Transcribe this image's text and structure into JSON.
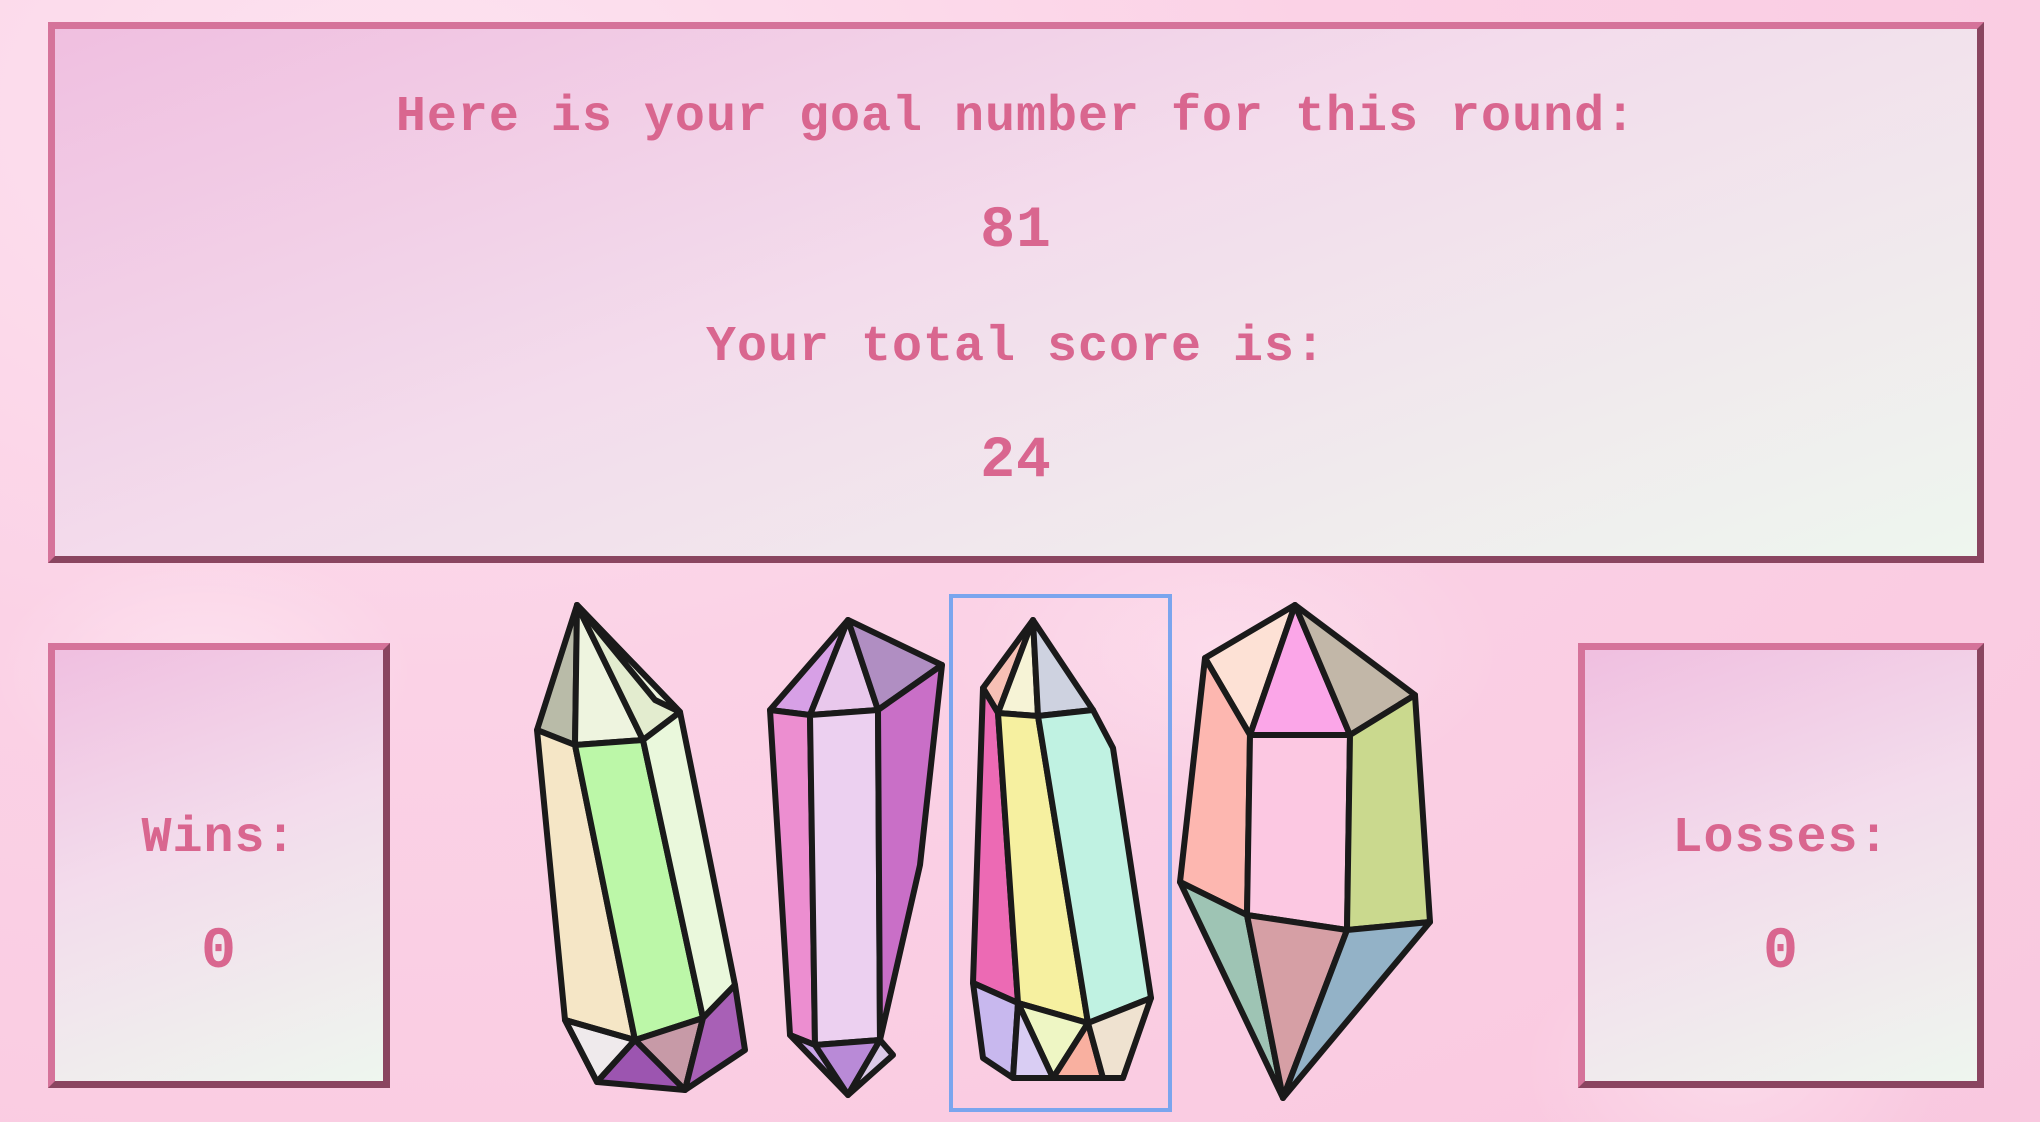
{
  "goal": {
    "label": "Here is your goal number for this round:",
    "value": "81"
  },
  "score": {
    "label": "Your total score is:",
    "value": "24"
  },
  "wins": {
    "label": "Wins:",
    "value": "0"
  },
  "losses": {
    "label": "Losses:",
    "value": "0"
  },
  "crystals": [
    {
      "name": "green-crystal"
    },
    {
      "name": "purple-crystal"
    },
    {
      "name": "yellow-crystal",
      "selected": true
    },
    {
      "name": "pastel-crystal"
    }
  ],
  "colors": {
    "text": "#d9668f",
    "border_light": "#d5739a",
    "border_dark": "#8a4560",
    "selection": "#7aa5ee"
  }
}
